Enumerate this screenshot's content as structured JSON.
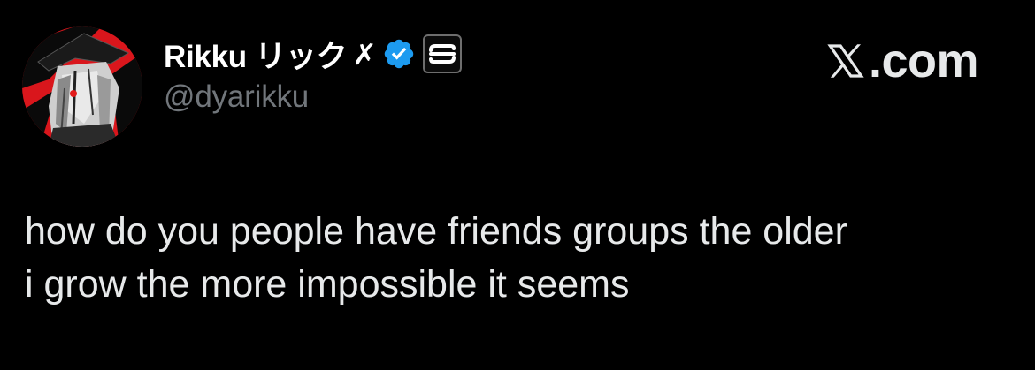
{
  "tweet": {
    "author": {
      "display_name": "Rikku リック",
      "name_suffix": "✗",
      "handle": "@dyarikku",
      "avatar_icon": "avatar-anime-character-icon",
      "verified_icon": "verified-badge-icon",
      "affiliate_icon": "affiliate-badge-icon"
    },
    "site": {
      "logo_icon": "x-logo-icon",
      "domain_text": ".com"
    },
    "text_lines": [
      "how do you people have friends groups the older",
      "i grow the more impossible it seems"
    ]
  },
  "colors": {
    "background": "#000000",
    "primary_text": "#e7e9ea",
    "name_text": "#ffffff",
    "secondary_text": "#71767b",
    "verified_blue": "#1d9bf0",
    "avatar_red": "#d9161c"
  }
}
